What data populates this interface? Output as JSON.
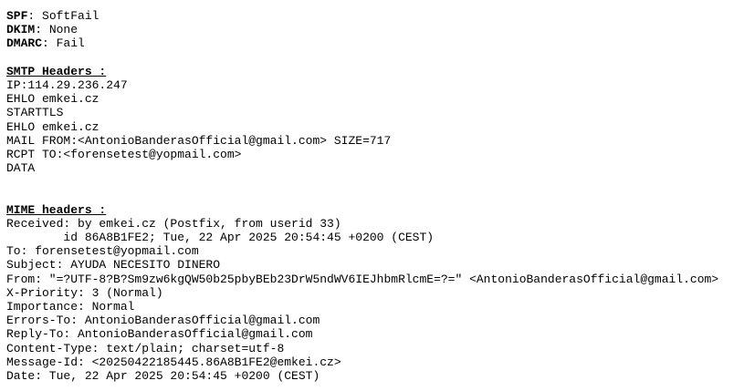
{
  "auth": {
    "spf": {
      "label": "SPF",
      "sep": ": ",
      "value": "SoftFail"
    },
    "dkim": {
      "label": "DKIM",
      "sep": ": ",
      "value": "None"
    },
    "dmarc": {
      "label": "DMARC",
      "sep": ": ",
      "value": "Fail"
    }
  },
  "smtp": {
    "heading": "SMTP Headers :",
    "lines": [
      "IP:114.29.236.247",
      "EHLO emkei.cz",
      "STARTTLS",
      "EHLO emkei.cz",
      "MAIL FROM:<AntonioBanderasOfficial@gmail.com> SIZE=717",
      "RCPT TO:<forensetest@yopmail.com>",
      "DATA"
    ]
  },
  "mime": {
    "heading": "MIME headers :",
    "lines": [
      "Received: by emkei.cz (Postfix, from userid 33)",
      "        id 86A8B1FE2; Tue, 22 Apr 2025 20:54:45 +0200 (CEST)",
      "To: forensetest@yopmail.com",
      "Subject: AYUDA NECESITO DINERO",
      "From: \"=?UTF-8?B?Sm9zw6kgQW50b25pbyBEb23DrW5ndWV6IEJhbmRlcmE=?=\" <AntonioBanderasOfficial@gmail.com>",
      "X-Priority: 3 (Normal)",
      "Importance: Normal",
      "Errors-To: AntonioBanderasOfficial@gmail.com",
      "Reply-To: AntonioBanderasOfficial@gmail.com",
      "Content-Type: text/plain; charset=utf-8",
      "Message-Id: <20250422185445.86A8B1FE2@emkei.cz>",
      "Date: Tue, 22 Apr 2025 20:54:45 +0200 (CEST)"
    ]
  }
}
